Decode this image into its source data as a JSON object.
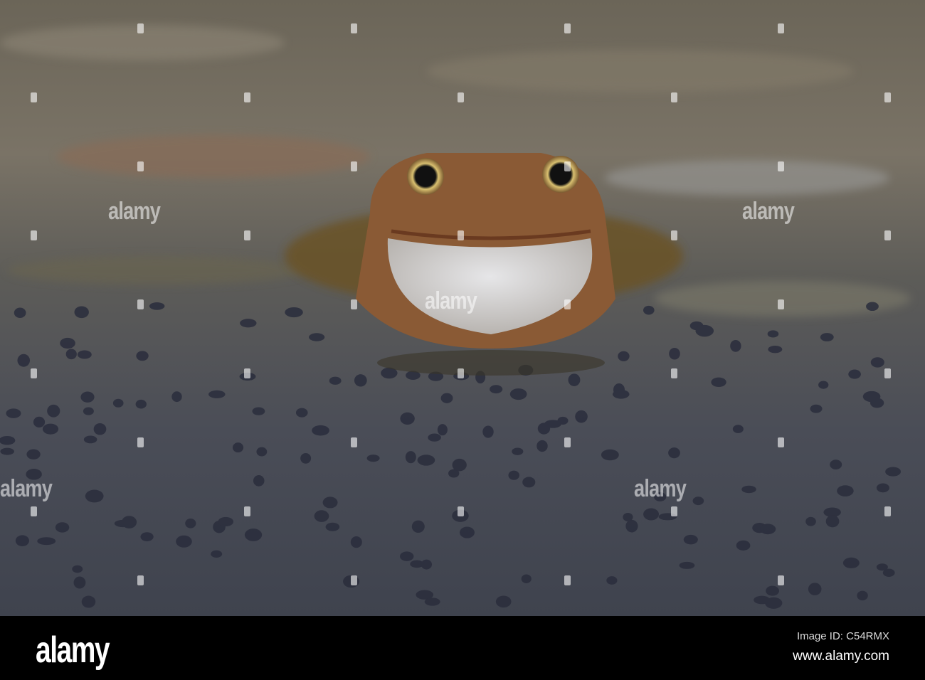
{
  "photo": {
    "subject": "frog-in-pond-with-frogspawn",
    "colors": {
      "water_dark": "#3e4350",
      "water_light": "#8a8a88",
      "frog_brown": "#8a5a35",
      "frog_throat": "#d8d8d8"
    }
  },
  "watermark": {
    "text": "alamy"
  },
  "footer": {
    "logo": "alamy",
    "image_id": "Image ID: C54RMX",
    "url": "www.alamy.com"
  }
}
